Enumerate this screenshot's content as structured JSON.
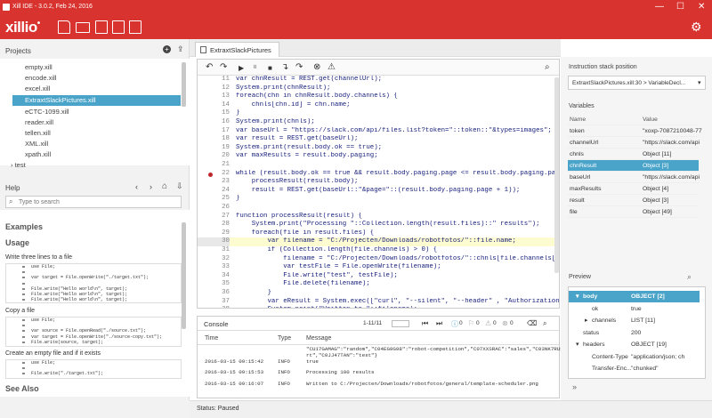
{
  "window": {
    "title": "Xill IDE - 3.0.2, Feb 24, 2016",
    "minimize": "—",
    "maximize": "☐",
    "close": "✕"
  },
  "appbar": {
    "logo": "xillio",
    "logo_dot": "•"
  },
  "projects": {
    "header": "Projects",
    "items": [
      {
        "label": "empty.xill"
      },
      {
        "label": "encode.xill"
      },
      {
        "label": "excel.xill"
      },
      {
        "label": "ExtraxtSlackPictures.xill",
        "selected": true
      },
      {
        "label": "eCTC-1099.xill"
      },
      {
        "label": "reader.xill"
      },
      {
        "label": "tellen.xill"
      },
      {
        "label": "XML.xill"
      },
      {
        "label": "xpath.xill"
      }
    ],
    "folder": "test"
  },
  "help": {
    "header": "Help",
    "search_placeholder": "Type to search",
    "examples_title": "Examples",
    "usage_title": "Usage",
    "section1": "Write three lines to a file",
    "code1": [
      "use File;",
      "",
      "var target = File.openWrite(\"./target.txt\");",
      "",
      "File.write(\"Hello world\\n\", target);",
      "File.write(\"Hello world\\n\", target);",
      "File.write(\"Hello world\\n\", target);"
    ],
    "section2": "Copy a file",
    "code2": [
      "use File;",
      "",
      "var source = File.openRead(\"./source.txt\");",
      "var target = File.openWrite(\"./source-copy.txt\");",
      "File.write(source, target);"
    ],
    "section3": "Create an empty file and if it exists",
    "code3": [
      "use File;",
      "",
      "File.write(\"./target.txt\");"
    ],
    "see_also": "See Also"
  },
  "editor": {
    "tab_label": "ExtraxtSlackPictures",
    "lines": [
      {
        "n": "11",
        "t": "var chnResult = REST.get(channelUrl);"
      },
      {
        "n": "12",
        "t": "System.print(chnResult);"
      },
      {
        "n": "13",
        "t": "foreach(chn in chnResult.body.channels) {"
      },
      {
        "n": "14",
        "t": "    chnls[chn.id] = chn.name;"
      },
      {
        "n": "15",
        "t": "}"
      },
      {
        "n": "16",
        "t": "System.print(chnls);"
      },
      {
        "n": "17",
        "t": "var baseUrl = \"https://slack.com/api/files.list?token=\"::token::\"&types=images\";"
      },
      {
        "n": "18",
        "t": "var result = REST.get(baseUrl);"
      },
      {
        "n": "19",
        "t": "System.print(result.body.ok == true);"
      },
      {
        "n": "20",
        "t": "var maxResults = result.body.paging;"
      },
      {
        "n": "21",
        "t": ""
      },
      {
        "n": "22",
        "t": "while (result.body.ok == true && result.body.paging.page <= result.body.paging.pag",
        "bp": true
      },
      {
        "n": "23",
        "t": "    processResult(result.body);"
      },
      {
        "n": "24",
        "t": "    result = REST.get(baseUrl::\"&page=\"::(result.body.paging.page + 1));"
      },
      {
        "n": "25",
        "t": "}"
      },
      {
        "n": "26",
        "t": ""
      },
      {
        "n": "27",
        "t": "function processResult(result) {"
      },
      {
        "n": "28",
        "t": "    System.print(\"Processing \"::Collection.length(result.files)::\" results\");"
      },
      {
        "n": "29",
        "t": "    foreach(file in result.files) {"
      },
      {
        "n": "30",
        "t": "        var filename = \"C:/Projecten/Downloads/robotfotos/\"::file.name;",
        "hl": true
      },
      {
        "n": "31",
        "t": "        if (Collection.length(file.channels) > 0) {"
      },
      {
        "n": "32",
        "t": "            filename = \"C:/Projecten/Downloads/robotfotos/\"::chnls[file.channels[0]]:"
      },
      {
        "n": "33",
        "t": "            var testFile = File.openWrite(filename);"
      },
      {
        "n": "34",
        "t": "            File.write(\"test\", testFile);"
      },
      {
        "n": "35",
        "t": "            File.delete(filename);"
      },
      {
        "n": "36",
        "t": "        }"
      },
      {
        "n": "37",
        "t": "        var eResult = System.exec([\"curl\", \"--silent\", \"--header\" , \"Authorization:B"
      },
      {
        "n": "38",
        "t": "        System.print(\"Written to \"::filename);"
      },
      {
        "n": "39",
        "t": "    }"
      },
      {
        "n": "40",
        "t": "}"
      }
    ]
  },
  "console": {
    "title": "Console",
    "pager": "1-11/11",
    "counts": [
      "0",
      "0",
      "0",
      "0"
    ],
    "col_time": "Time",
    "col_type": "Type",
    "col_message": "Message",
    "rows": [
      {
        "time": "",
        "type": "",
        "msg": "\"CU17GAMAG\":\"random\",\"C04EG9G98\":\"robot-competition\",\"C07XXSRAC\":\"sales\",\"C03NK7RUS\":\"suppo"
      },
      {
        "time": "",
        "type": "",
        "msg": "rt\",\"C0JJ47TAN\":\"test\"}"
      },
      {
        "time": "2016-03-15 09:15:42",
        "type": "INFO",
        "msg": "true"
      },
      {
        "time": "2016-03-15 09:15:53",
        "type": "INFO",
        "msg": "Processing 100 results"
      },
      {
        "time": "2016-03-15 09:16:07",
        "type": "INFO",
        "msg": "Written to C:/Projecten/Downloads/robotfotos/general/template-scheduler.png"
      }
    ]
  },
  "instruction_stack": {
    "label": "Instruction stack position",
    "value": "ExtraxtSlackPictures.xill:30 > VariableDecl..."
  },
  "variables": {
    "label": "Variables",
    "col_name": "Name",
    "col_value": "Value",
    "rows": [
      {
        "name": "token",
        "value": "\"xoxp-7087210048-77"
      },
      {
        "name": "channelUrl",
        "value": "\"https://slack.com/api"
      },
      {
        "name": "chnls",
        "value": "Object [11]"
      },
      {
        "name": "chnResult",
        "value": "Object [3]",
        "selected": true
      },
      {
        "name": "baseUrl",
        "value": "\"https://slack.com/api"
      },
      {
        "name": "maxResults",
        "value": "Object [4]"
      },
      {
        "name": "result",
        "value": "Object [3]"
      },
      {
        "name": "file",
        "value": "Object [49]"
      }
    ]
  },
  "preview": {
    "label": "Preview",
    "rows": [
      {
        "name": "body",
        "value": "OBJECT [2]",
        "indent": 1,
        "selected": true,
        "toggle": "▾"
      },
      {
        "name": "ok",
        "value": "true",
        "indent": 2,
        "toggle": ""
      },
      {
        "name": "channels",
        "value": "LIST [11]",
        "indent": 2,
        "toggle": "▸"
      },
      {
        "name": "status",
        "value": "200",
        "indent": 1,
        "toggle": ""
      },
      {
        "name": "headers",
        "value": "OBJECT [19]",
        "indent": 1,
        "toggle": "▾"
      },
      {
        "name": "Content-Type",
        "value": "\"application/json; ch",
        "indent": 2,
        "toggle": ""
      },
      {
        "name": "Transfer-Enc...",
        "value": "\"chunked\"",
        "indent": 2,
        "toggle": ""
      }
    ]
  },
  "status": {
    "text": "Status: Paused"
  },
  "colors": {
    "brand": "#d8332f",
    "selection": "#4aa3c8"
  }
}
